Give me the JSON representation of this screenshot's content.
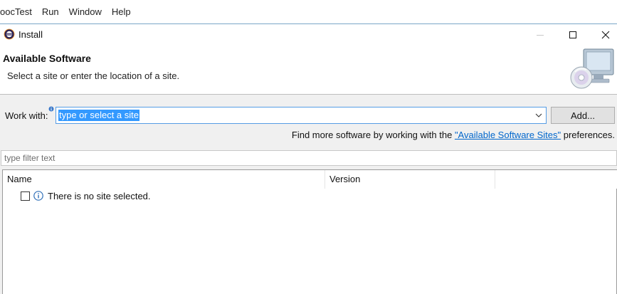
{
  "menubar": {
    "items": [
      "oocTest",
      "Run",
      "Window",
      "Help"
    ]
  },
  "dialog": {
    "title": "Install",
    "header": {
      "title": "Available Software",
      "subtitle": "Select a site or enter the location of a site."
    },
    "work_with": {
      "label": "Work with:",
      "value": "type or select a site"
    },
    "add_button": "Add...",
    "find_more": {
      "prefix": "Find more software by working with the ",
      "link": "\"Available Software Sites\"",
      "suffix": " preferences."
    },
    "filter": {
      "placeholder": "type filter text"
    },
    "table": {
      "columns": [
        "Name",
        "Version"
      ],
      "rows": [
        {
          "text": "There is no site selected.",
          "checked": false,
          "icon": "info-icon"
        }
      ]
    }
  },
  "colors": {
    "selection": "#3399ff",
    "link": "#0066cc",
    "focus_border": "#569de5"
  }
}
